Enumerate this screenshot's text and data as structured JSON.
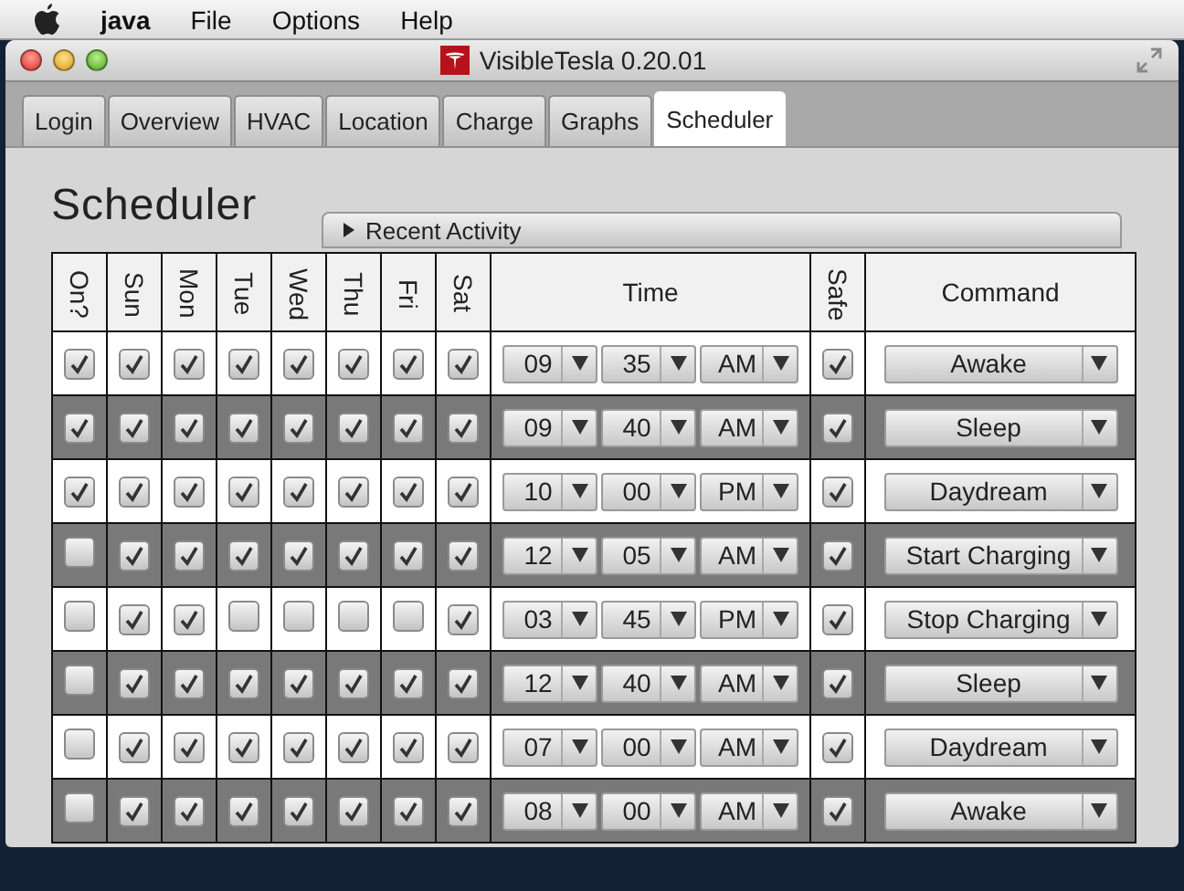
{
  "menu_bar": {
    "app_name": "java",
    "items": [
      "File",
      "Options",
      "Help"
    ]
  },
  "window": {
    "title": "VisibleTesla 0.20.01"
  },
  "tabs": [
    {
      "label": "Login",
      "selected": false
    },
    {
      "label": "Overview",
      "selected": false
    },
    {
      "label": "HVAC",
      "selected": false
    },
    {
      "label": "Location",
      "selected": false
    },
    {
      "label": "Charge",
      "selected": false
    },
    {
      "label": "Graphs",
      "selected": false
    },
    {
      "label": "Scheduler",
      "selected": true
    }
  ],
  "heading": "Scheduler",
  "recent_activity": {
    "label": "Recent Activity",
    "expanded": false
  },
  "table": {
    "columns": [
      {
        "label": "On?",
        "kind": "check"
      },
      {
        "label": "Sun",
        "kind": "check"
      },
      {
        "label": "Mon",
        "kind": "check"
      },
      {
        "label": "Tue",
        "kind": "check"
      },
      {
        "label": "Wed",
        "kind": "check"
      },
      {
        "label": "Thu",
        "kind": "check"
      },
      {
        "label": "Fri",
        "kind": "check"
      },
      {
        "label": "Sat",
        "kind": "check"
      },
      {
        "label": "Time",
        "kind": "time"
      },
      {
        "label": "Safe",
        "kind": "check"
      },
      {
        "label": "Command",
        "kind": "command"
      }
    ],
    "rows": [
      {
        "on": true,
        "days": [
          true,
          true,
          true,
          true,
          true,
          true,
          true
        ],
        "hour": "09",
        "minute": "35",
        "period": "AM",
        "safe": true,
        "command": "Awake"
      },
      {
        "on": true,
        "days": [
          true,
          true,
          true,
          true,
          true,
          true,
          true
        ],
        "hour": "09",
        "minute": "40",
        "period": "AM",
        "safe": true,
        "command": "Sleep"
      },
      {
        "on": true,
        "days": [
          true,
          true,
          true,
          true,
          true,
          true,
          true
        ],
        "hour": "10",
        "minute": "00",
        "period": "PM",
        "safe": true,
        "command": "Daydream"
      },
      {
        "on": false,
        "days": [
          true,
          true,
          true,
          true,
          true,
          true,
          true
        ],
        "hour": "12",
        "minute": "05",
        "period": "AM",
        "safe": true,
        "command": "Start Charging"
      },
      {
        "on": false,
        "days": [
          true,
          true,
          false,
          false,
          false,
          false,
          true
        ],
        "hour": "03",
        "minute": "45",
        "period": "PM",
        "safe": true,
        "command": "Stop Charging"
      },
      {
        "on": false,
        "days": [
          true,
          true,
          true,
          true,
          true,
          true,
          true
        ],
        "hour": "12",
        "minute": "40",
        "period": "AM",
        "safe": true,
        "command": "Sleep"
      },
      {
        "on": false,
        "days": [
          true,
          true,
          true,
          true,
          true,
          true,
          true
        ],
        "hour": "07",
        "minute": "00",
        "period": "AM",
        "safe": true,
        "command": "Daydream"
      },
      {
        "on": false,
        "days": [
          true,
          true,
          true,
          true,
          true,
          true,
          true
        ],
        "hour": "08",
        "minute": "00",
        "period": "AM",
        "safe": true,
        "command": "Awake"
      }
    ]
  }
}
